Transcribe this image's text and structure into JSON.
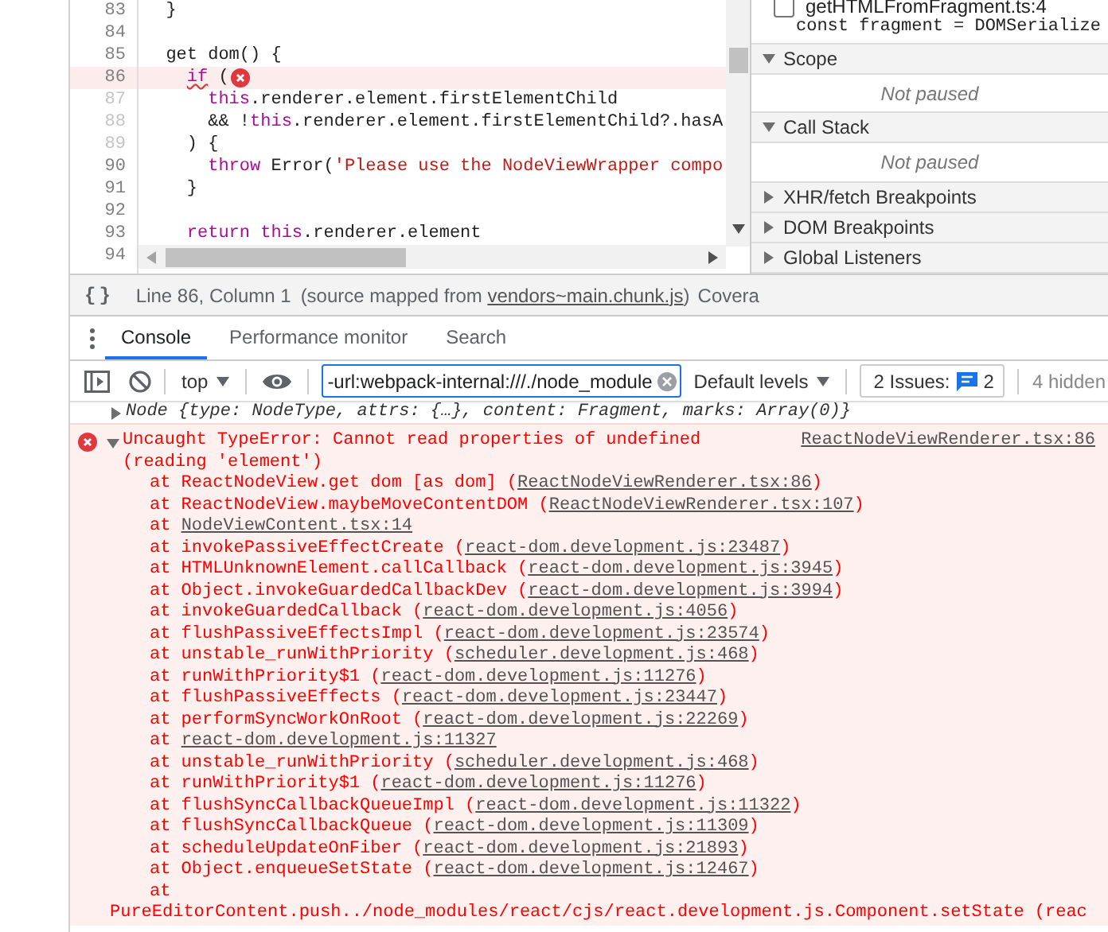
{
  "editor": {
    "lines": [
      {
        "number": "83",
        "dim": false,
        "error": false,
        "tokens": [
          {
            "text": "  }",
            "kind": "plain"
          }
        ]
      },
      {
        "number": "84",
        "dim": false,
        "error": false
      },
      {
        "number": "85",
        "dim": false,
        "error": false,
        "tokens": [
          {
            "text": "  get dom() {",
            "kind": "plain"
          }
        ]
      },
      {
        "number": "86",
        "dim": false,
        "error": true,
        "tokens": [
          {
            "text": "    if",
            "kind": "keyword"
          },
          {
            "text": " (",
            "kind": "plain"
          }
        ]
      },
      {
        "number": "87",
        "dim": true,
        "error": false,
        "tokens": [
          {
            "text": "      this",
            "kind": "keyword"
          },
          {
            "text": ".renderer.element.firstElementChild",
            "kind": "plain"
          }
        ]
      },
      {
        "number": "88",
        "dim": true,
        "error": false,
        "tokens": [
          {
            "text": "      && !",
            "kind": "plain"
          },
          {
            "text": "this",
            "kind": "keyword"
          },
          {
            "text": ".renderer.element.firstElementChild?.hasA",
            "kind": "plain"
          }
        ]
      },
      {
        "number": "89",
        "dim": true,
        "error": false,
        "tokens": [
          {
            "text": "    ) {",
            "kind": "plain"
          }
        ]
      },
      {
        "number": "90",
        "dim": false,
        "error": false,
        "tokens": [
          {
            "text": "      throw",
            "kind": "keyword"
          },
          {
            "text": " Error(",
            "kind": "plain"
          },
          {
            "text": "'Please use the NodeViewWrapper compo",
            "kind": "string"
          }
        ]
      },
      {
        "number": "91",
        "dim": false,
        "error": false,
        "tokens": [
          {
            "text": "    }",
            "kind": "plain"
          }
        ]
      },
      {
        "number": "92",
        "dim": false,
        "error": false
      },
      {
        "number": "93",
        "dim": false,
        "error": false,
        "tokens": [
          {
            "text": "    return",
            "kind": "keyword"
          },
          {
            "text": " this",
            "kind": "keyword"
          },
          {
            "text": ".renderer.element",
            "kind": "plain"
          }
        ]
      },
      {
        "number": "94",
        "dim": false,
        "error": false
      }
    ]
  },
  "status_bar": {
    "pretty_print": "{}",
    "position": "Line 86, Column 1",
    "source_prefix": "(source mapped from ",
    "source_link": "vendors~main.chunk.js",
    "source_suffix": ")",
    "coverage": "Covera"
  },
  "sidebar": {
    "breakpoint": {
      "file": "getHTMLFromFragment.ts:4",
      "code": "const fragment = DOMSerialize",
      "checked": false
    },
    "sections": [
      {
        "title": "Scope",
        "expanded": true,
        "message": "Not paused"
      },
      {
        "title": "Call Stack",
        "expanded": true,
        "message": "Not paused"
      },
      {
        "title": "XHR/fetch Breakpoints",
        "expanded": false
      },
      {
        "title": "DOM Breakpoints",
        "expanded": false
      },
      {
        "title": "Global Listeners",
        "expanded": false
      }
    ]
  },
  "drawer_tabs": [
    {
      "label": "Console",
      "selected": true
    },
    {
      "label": "Performance monitor",
      "selected": false
    },
    {
      "label": "Search",
      "selected": false
    }
  ],
  "toolbar": {
    "context": "top",
    "filter": "-url:webpack-internal:///./node_module",
    "levels": "Default levels",
    "issues_label": "2 Issues:",
    "issues_count": "2",
    "hidden": "4 hidden"
  },
  "console": {
    "object_row": "Node {type: NodeType, attrs: {…}, content: Fragment, marks: Array(0)}",
    "error": {
      "message": "Uncaught TypeError: Cannot read properties of undefined (reading 'element')",
      "source": "ReactNodeViewRenderer.tsx:86",
      "expanded": true,
      "frames": [
        {
          "prefix": "at ReactNodeView.get dom [as dom] (",
          "link": "ReactNodeViewRenderer.tsx:86",
          "suffix": ")"
        },
        {
          "prefix": "at ReactNodeView.maybeMoveContentDOM (",
          "link": "ReactNodeViewRenderer.tsx:107",
          "suffix": ")"
        },
        {
          "prefix": "at ",
          "link": "NodeViewContent.tsx:14"
        },
        {
          "prefix": "at invokePassiveEffectCreate (",
          "link": "react-dom.development.js:23487",
          "suffix": ")"
        },
        {
          "prefix": "at HTMLUnknownElement.callCallback (",
          "link": "react-dom.development.js:3945",
          "suffix": ")"
        },
        {
          "prefix": "at Object.invokeGuardedCallbackDev (",
          "link": "react-dom.development.js:3994",
          "suffix": ")"
        },
        {
          "prefix": "at invokeGuardedCallback (",
          "link": "react-dom.development.js:4056",
          "suffix": ")"
        },
        {
          "prefix": "at flushPassiveEffectsImpl (",
          "link": "react-dom.development.js:23574",
          "suffix": ")"
        },
        {
          "prefix": "at unstable_runWithPriority (",
          "link": "scheduler.development.js:468",
          "suffix": ")"
        },
        {
          "prefix": "at runWithPriority$1 (",
          "link": "react-dom.development.js:11276",
          "suffix": ")"
        },
        {
          "prefix": "at flushPassiveEffects (",
          "link": "react-dom.development.js:23447",
          "suffix": ")"
        },
        {
          "prefix": "at performSyncWorkOnRoot (",
          "link": "react-dom.development.js:22269",
          "suffix": ")"
        },
        {
          "prefix": "at ",
          "link": "react-dom.development.js:11327"
        },
        {
          "prefix": "at unstable_runWithPriority (",
          "link": "scheduler.development.js:468",
          "suffix": ")"
        },
        {
          "prefix": "at runWithPriority$1 (",
          "link": "react-dom.development.js:11276",
          "suffix": ")"
        },
        {
          "prefix": "at flushSyncCallbackQueueImpl (",
          "link": "react-dom.development.js:11322",
          "suffix": ")"
        },
        {
          "prefix": "at flushSyncCallbackQueue (",
          "link": "react-dom.development.js:11309",
          "suffix": ")"
        },
        {
          "prefix": "at scheduleUpdateOnFiber (",
          "link": "react-dom.development.js:21893",
          "suffix": ")"
        },
        {
          "prefix": "at Object.enqueueSetState (",
          "link": "react-dom.development.js:12467",
          "suffix": ")"
        },
        {
          "prefix": "at"
        }
      ],
      "continuation": "PureEditorContent.push../node_modules/react/cjs/react.development.js.Component.setState (reac"
    }
  }
}
